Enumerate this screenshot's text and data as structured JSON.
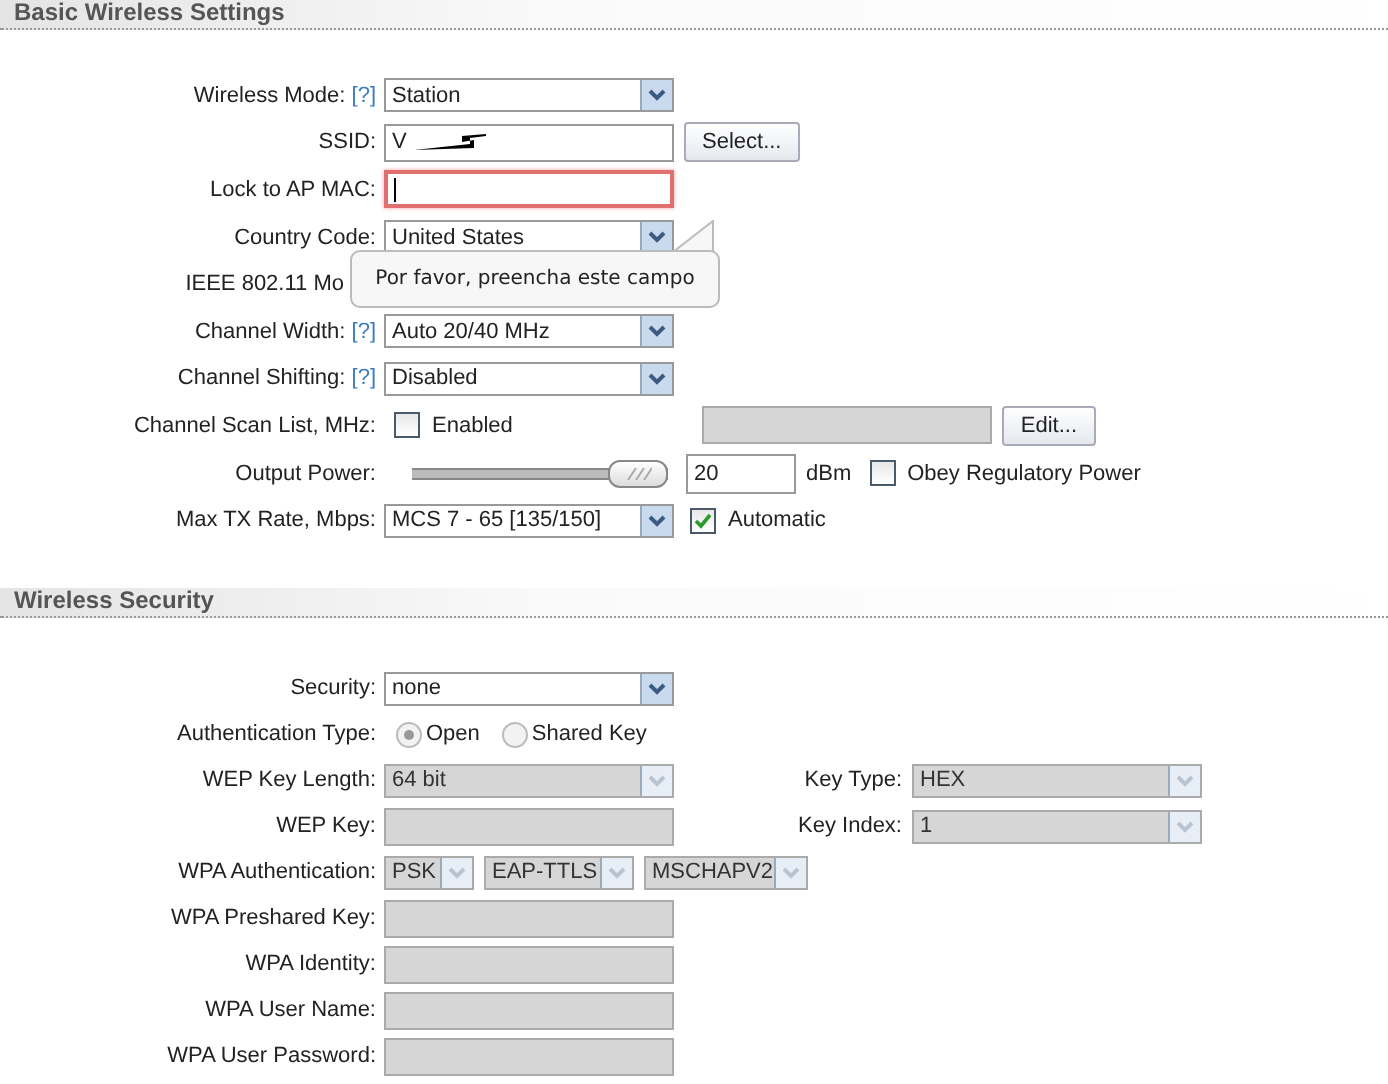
{
  "sections": [
    {
      "title": "Basic Wireless Settings",
      "rows": [
        {
          "kind": "select",
          "label": "Wireless Mode:",
          "help": "[?]",
          "value": "Station",
          "disabled": false
        },
        {
          "kind": "text_button",
          "label": "SSID:",
          "value": "V",
          "redacted": true,
          "button": "Select..."
        },
        {
          "kind": "text",
          "label": "Lock to AP MAC:",
          "invalid": true,
          "disabled": false
        },
        {
          "kind": "select",
          "label": "Country Code:",
          "value": "United States",
          "disabled": false
        },
        {
          "kind": "covered",
          "label": "IEEE 802.11 Mo"
        },
        {
          "kind": "select",
          "label": "Channel Width:",
          "help": "[?]",
          "value": "Auto 20/40 MHz",
          "disabled": false
        },
        {
          "kind": "select",
          "label": "Channel Shifting:",
          "help": "[?]",
          "value": "Disabled",
          "disabled": false
        },
        {
          "kind": "check_list",
          "label": "Channel Scan List, MHz:",
          "check": {
            "label": "Enabled",
            "checked": false
          },
          "button": "Edit..."
        },
        {
          "kind": "slider",
          "label": "Output Power:",
          "level": 1,
          "value": "20",
          "unit": "dBm",
          "check": {
            "label": "Obey Regulatory Power",
            "checked": false
          }
        },
        {
          "kind": "select_check",
          "label": "Max TX Rate, Mbps:",
          "value": "MCS 7 - 65 [135/150]",
          "disabled": false,
          "check": {
            "label": "Automatic",
            "checked": true
          }
        }
      ]
    },
    {
      "title": "Wireless Security",
      "rows": [
        {
          "kind": "select",
          "label": "Security:",
          "value": "none",
          "disabled": false
        },
        {
          "kind": "radio",
          "label": "Authentication Type:",
          "disabled": true,
          "options": [
            {
              "label": "Open",
              "selected": true
            },
            {
              "label": "Shared Key",
              "selected": false
            }
          ]
        },
        {
          "kind": "select",
          "label": "WEP Key Length:",
          "value": "64 bit",
          "disabled": true,
          "side": {
            "label": "Key Type:",
            "value": "HEX",
            "disabled": true
          }
        },
        {
          "kind": "text",
          "label": "WEP Key:",
          "disabled": true,
          "side": {
            "label": "Key Index:",
            "value": "1",
            "disabled": true
          }
        },
        {
          "kind": "multi_select",
          "label": "WPA Authentication:",
          "disabled": true,
          "values": [
            "PSK",
            "EAP-TTLS",
            "MSCHAPV2"
          ]
        },
        {
          "kind": "text",
          "label": "WPA Preshared Key:",
          "disabled": true
        },
        {
          "kind": "text",
          "label": "WPA Identity:",
          "disabled": true
        },
        {
          "kind": "text",
          "label": "WPA User Name:",
          "disabled": true
        },
        {
          "kind": "text",
          "label": "WPA User Password:",
          "disabled": true
        }
      ]
    }
  ],
  "validation_tooltip": "Por favor, preencha este campo"
}
